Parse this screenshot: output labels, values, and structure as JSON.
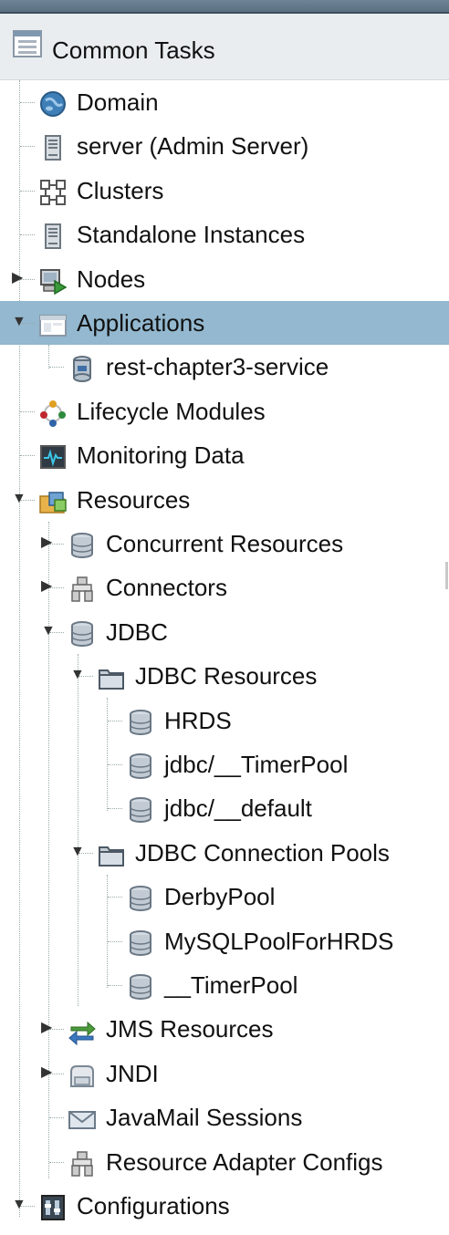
{
  "header": {
    "title": "Common Tasks",
    "icon": "tasks-icon"
  },
  "tree": [
    {
      "label": "Domain",
      "icon": "globe-icon",
      "toggle": ""
    },
    {
      "label": "server (Admin Server)",
      "icon": "server-icon",
      "toggle": ""
    },
    {
      "label": "Clusters",
      "icon": "cluster-icon",
      "toggle": ""
    },
    {
      "label": "Standalone Instances",
      "icon": "server-icon",
      "toggle": ""
    },
    {
      "label": "Nodes",
      "icon": "node-icon",
      "toggle": "collapsed"
    },
    {
      "label": "Applications",
      "icon": "applications-icon",
      "toggle": "expanded",
      "selected": true
    },
    {
      "label": "rest-chapter3-service",
      "icon": "jar-icon",
      "toggle": ""
    },
    {
      "label": "Lifecycle Modules",
      "icon": "lifecycle-icon",
      "toggle": ""
    },
    {
      "label": "Monitoring Data",
      "icon": "monitor-icon",
      "toggle": ""
    },
    {
      "label": "Resources",
      "icon": "resources-folder-icon",
      "toggle": "expanded"
    },
    {
      "label": "Concurrent Resources",
      "icon": "database-icon",
      "toggle": "collapsed"
    },
    {
      "label": "Connectors",
      "icon": "connector-icon",
      "toggle": "collapsed"
    },
    {
      "label": "JDBC",
      "icon": "database-icon",
      "toggle": "expanded"
    },
    {
      "label": "JDBC Resources",
      "icon": "folder-icon",
      "toggle": "expanded"
    },
    {
      "label": "HRDS",
      "icon": "database-icon",
      "toggle": ""
    },
    {
      "label": "jdbc/__TimerPool",
      "icon": "database-icon",
      "toggle": ""
    },
    {
      "label": "jdbc/__default",
      "icon": "database-icon",
      "toggle": ""
    },
    {
      "label": "JDBC Connection Pools",
      "icon": "folder-icon",
      "toggle": "expanded"
    },
    {
      "label": "DerbyPool",
      "icon": "database-icon",
      "toggle": ""
    },
    {
      "label": "MySQLPoolForHRDS",
      "icon": "database-icon",
      "toggle": ""
    },
    {
      "label": "__TimerPool",
      "icon": "database-icon",
      "toggle": ""
    },
    {
      "label": "JMS Resources",
      "icon": "jms-icon",
      "toggle": "collapsed"
    },
    {
      "label": "JNDI",
      "icon": "jndi-icon",
      "toggle": "collapsed"
    },
    {
      "label": "JavaMail Sessions",
      "icon": "mail-icon",
      "toggle": ""
    },
    {
      "label": "Resource Adapter Configs",
      "icon": "connector-icon",
      "toggle": ""
    },
    {
      "label": "Configurations",
      "icon": "config-icon",
      "toggle": "expanded"
    }
  ],
  "colors": {
    "selected": "#93b8cf",
    "header": "#e9edf0",
    "topbar": "#5f7486"
  }
}
